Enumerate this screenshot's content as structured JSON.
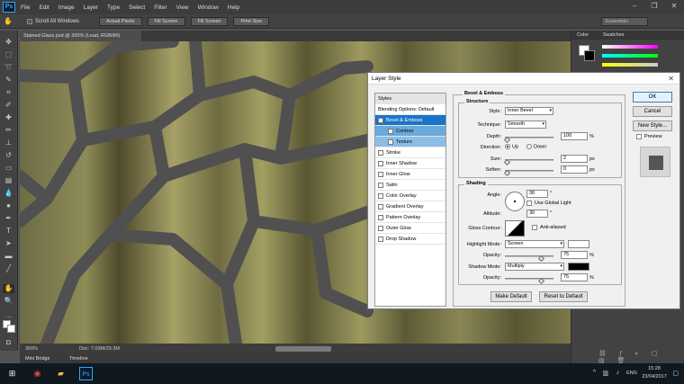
{
  "app": {
    "logo": "Ps"
  },
  "menu": [
    "File",
    "Edit",
    "Image",
    "Layer",
    "Type",
    "Select",
    "Filter",
    "View",
    "Window",
    "Help"
  ],
  "window_controls": [
    "–",
    "❐",
    "✕"
  ],
  "options_bar": {
    "scroll_all_label": "Scroll All Windows",
    "buttons": [
      "Actual Pixels",
      "Fill Screen",
      "Fill Screen",
      "Print Size"
    ],
    "workspace": "Essentials"
  },
  "document": {
    "tab_title": "Stained Glass.psd @ 300% (Lead, RGB/8#)"
  },
  "status": {
    "zoom": "300%",
    "doc_info": "Doc: 7.03M/29.3M"
  },
  "bottom_tabs": [
    "Mini Bridge",
    "Timeline"
  ],
  "right_panel": {
    "tabs": [
      "Color",
      "Swatches"
    ]
  },
  "taskbar": {
    "lang": "ENG",
    "time": "15:28",
    "date": "23/04/2017"
  },
  "layer_style": {
    "title": "Layer Style",
    "close_label": "✕",
    "styles_header": "Styles",
    "blending_options": "Blending Options: Default",
    "effects": [
      {
        "label": "Bevel & Emboss",
        "checked": true
      },
      {
        "label": "Contour",
        "checked": false
      },
      {
        "label": "Texture",
        "checked": false
      },
      {
        "label": "Stroke",
        "checked": false
      },
      {
        "label": "Inner Shadow",
        "checked": false
      },
      {
        "label": "Inner Glow",
        "checked": false
      },
      {
        "label": "Satin",
        "checked": false
      },
      {
        "label": "Color Overlay",
        "checked": false
      },
      {
        "label": "Gradient Overlay",
        "checked": false
      },
      {
        "label": "Pattern Overlay",
        "checked": false
      },
      {
        "label": "Outer Glow",
        "checked": false
      },
      {
        "label": "Drop Shadow",
        "checked": false
      }
    ],
    "section_title": "Bevel & Emboss",
    "structure": {
      "title": "Structure",
      "style_label": "Style:",
      "style_value": "Inner Bevel",
      "technique_label": "Technique:",
      "technique_value": "Smooth",
      "depth_label": "Depth:",
      "depth_value": "100",
      "depth_unit": "%",
      "direction_label": "Direction:",
      "direction_up": "Up",
      "direction_down": "Down",
      "size_label": "Size:",
      "size_value": "2",
      "size_unit": "px",
      "soften_label": "Soften:",
      "soften_value": "0",
      "soften_unit": "px"
    },
    "shading": {
      "title": "Shading",
      "angle_label": "Angle:",
      "angle_value": "30",
      "angle_unit": "°",
      "global_light_label": "Use Global Light",
      "altitude_label": "Altitude:",
      "altitude_value": "30",
      "altitude_unit": "°",
      "gloss_label": "Gloss Contour:",
      "anti_aliased_label": "Anti-aliased",
      "highlight_mode_label": "Highlight Mode:",
      "highlight_mode_value": "Screen",
      "highlight_color": "#ffffff",
      "opacity_label": "Opacity:",
      "highlight_opacity": "75",
      "opacity_unit": "%",
      "shadow_mode_label": "Shadow Mode:",
      "shadow_mode_value": "Multiply",
      "shadow_color": "#000000",
      "shadow_opacity": "75"
    },
    "make_default": "Make Default",
    "reset_default": "Reset to Default",
    "ok": "OK",
    "cancel": "Cancel",
    "new_style": "New Style...",
    "preview_label": "Preview"
  }
}
